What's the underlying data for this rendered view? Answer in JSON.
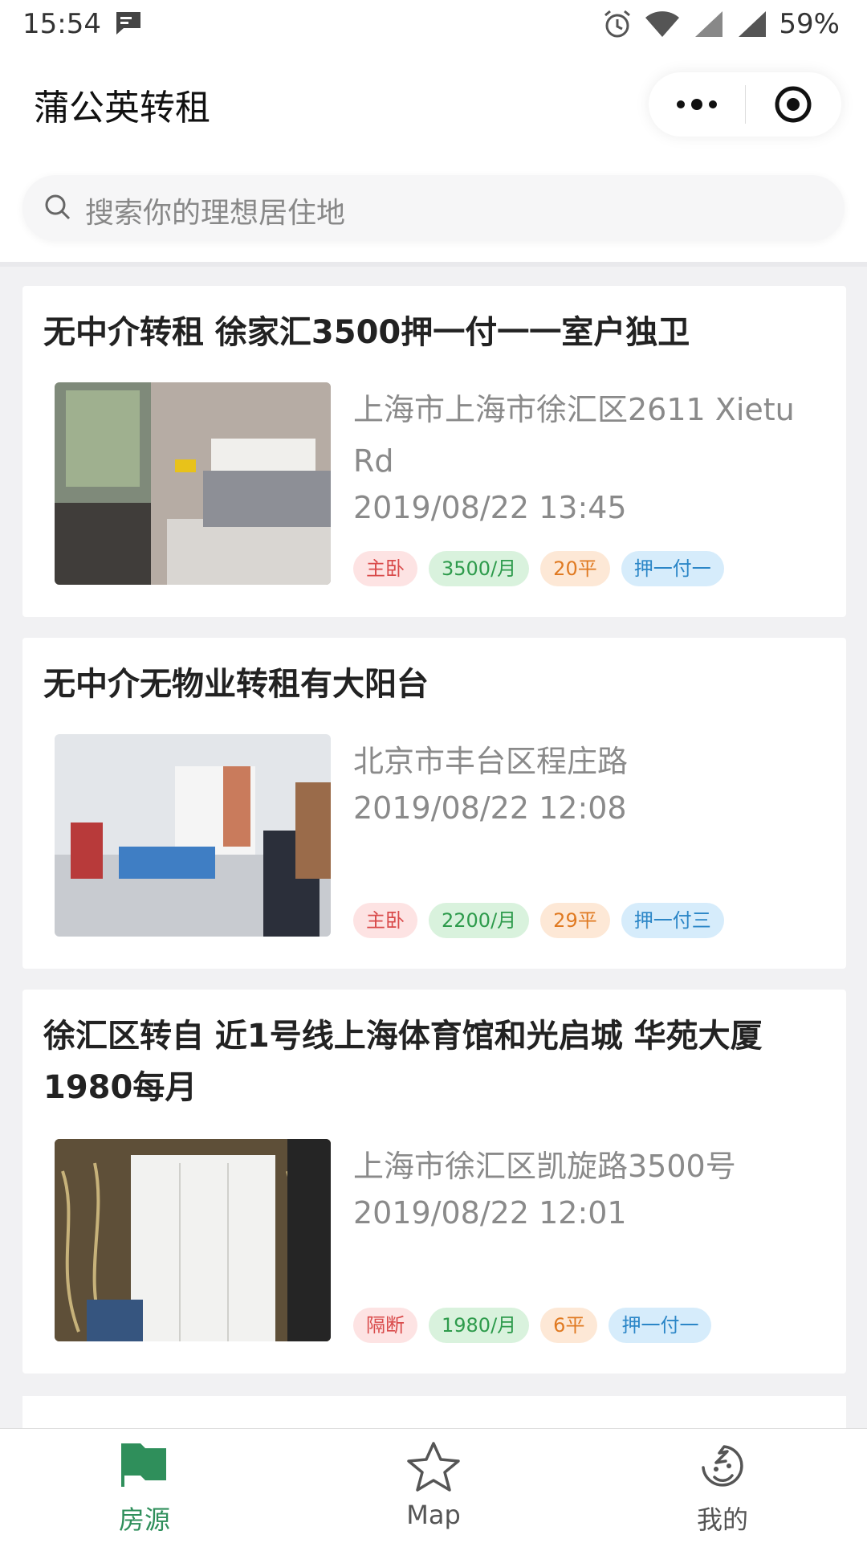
{
  "status_bar": {
    "time": "15:54",
    "battery": "59%"
  },
  "header": {
    "title": "蒲公英转租"
  },
  "search": {
    "placeholder": "搜索你的理想居住地"
  },
  "listings": [
    {
      "title": "无中介转租 徐家汇3500押一付一一室户独卫",
      "address": "上海市上海市徐汇区2611 Xietu Rd",
      "date": "2019/08/22 13:45",
      "tags": [
        "主卧",
        "3500/月",
        "20平",
        "押一付一"
      ]
    },
    {
      "title": "无中介无物业转租有大阳台",
      "address": "北京市丰台区程庄路",
      "date": "2019/08/22 12:08",
      "tags": [
        "主卧",
        "2200/月",
        "29平",
        "押一付三"
      ]
    },
    {
      "title": "徐汇区转自 近1号线上海体育馆和光启城 华苑大厦 1980每月",
      "address": "上海市徐汇区凯旋路3500号",
      "date": "2019/08/22 12:01",
      "tags": [
        "隔断",
        "1980/月",
        "6平",
        "押一付一"
      ]
    }
  ],
  "tabbar": {
    "tabs": [
      "房源",
      "Map",
      "我的"
    ],
    "active": 0
  },
  "colors": {
    "accent": "#2f8f5b",
    "tag_red": "#d94a4a",
    "tag_green": "#2e9b4c",
    "tag_orange": "#e07a22",
    "tag_blue": "#2b86c7"
  }
}
